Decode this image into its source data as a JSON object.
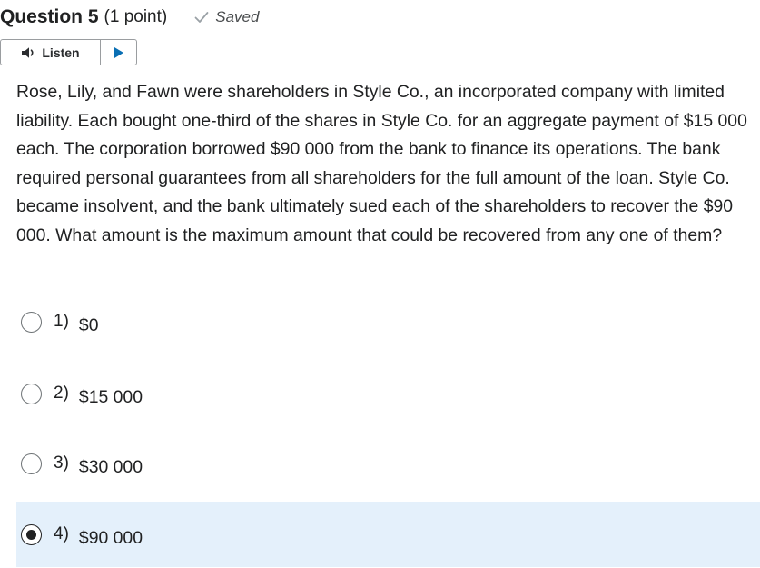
{
  "question": {
    "title": "Question 5",
    "points": "(1 point)",
    "status": "Saved",
    "status_icon": "check-icon",
    "text": "Rose, Lily, and Fawn were shareholders in Style Co., an incorporated company with limited liability. Each bought one-third of the shares in Style Co. for an aggregate payment of $15 000 each. The corporation borrowed $90 000 from the bank to finance its operations. The bank required personal guarantees from all shareholders for the full amount of the loan. Style Co. became insolvent, and the bank ultimately sued each of the shareholders to recover the $90 000. What amount is the maximum amount that could be recovered from any one of them?"
  },
  "listen": {
    "label": "Listen",
    "speaker_icon": "speaker-icon",
    "play_icon": "play-icon"
  },
  "options": [
    {
      "number": "1)",
      "text": "$0",
      "selected": false
    },
    {
      "number": "2)",
      "text": "$15 000",
      "selected": false
    },
    {
      "number": "3)",
      "text": "$30 000",
      "selected": false
    },
    {
      "number": "4)",
      "text": "$90 000",
      "selected": true
    }
  ],
  "colors": {
    "selected_bg": "#e4f0fb",
    "play_accent": "#0a6fb4",
    "text": "#202122",
    "saved_check": "#9aa1a6"
  }
}
